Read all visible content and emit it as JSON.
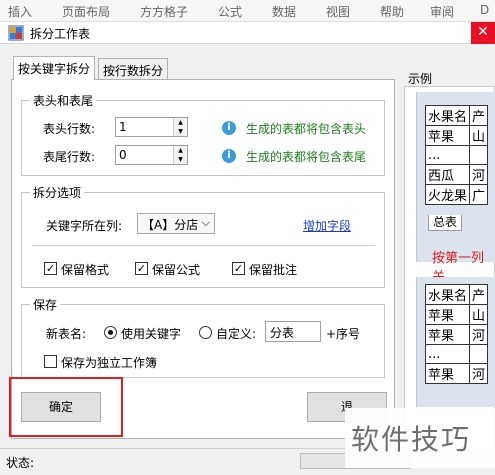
{
  "ribbon": [
    "插入",
    "页面布局",
    "方方格子",
    "公式",
    "数据",
    "视图",
    "帮助",
    "审阅",
    "D"
  ],
  "window": {
    "title": "拆分工作表",
    "close": "✕"
  },
  "tabs": [
    "按关键字拆分",
    "按行数拆分"
  ],
  "header_footer": {
    "legend": "表头和表尾",
    "header_label": "表头行数:",
    "header_value": "1",
    "header_hint": "生成的表都将包含表头",
    "footer_label": "表尾行数:",
    "footer_value": "0",
    "footer_hint": "生成的表都将包含表尾",
    "info_glyph": "i"
  },
  "split_options": {
    "legend": "拆分选项",
    "key_col_label": "关键字所在列:",
    "key_col_value": "【A】分店",
    "add_field": "增加字段",
    "keep_format": "保留格式",
    "keep_formula": "保留公式",
    "keep_comment": "保留批注",
    "check_glyph": "✓"
  },
  "save": {
    "legend": "保存",
    "new_name_label": "新表名:",
    "use_key": "使用关键字",
    "custom": "自定义:",
    "custom_value": "分表",
    "suffix": "+序号",
    "separate_workbook": "保存为独立工作簿"
  },
  "buttons": {
    "ok": "确定",
    "exit": "退"
  },
  "example": {
    "label": "示例",
    "table1": [
      [
        "水果名",
        "产"
      ],
      [
        "苹果",
        "山"
      ],
      [
        "...",
        ""
      ],
      [
        "西瓜",
        "河"
      ],
      [
        "火龙果",
        "广"
      ]
    ],
    "sheet_tab": "总表",
    "split_text": "按第一列关",
    "table2": [
      [
        "水果名",
        "产"
      ],
      [
        "苹果",
        "山"
      ],
      [
        "苹果",
        "河"
      ],
      [
        "...",
        ""
      ],
      [
        "苹果",
        "河"
      ]
    ]
  },
  "status": {
    "label": "状态:"
  },
  "watermark": "软件技巧",
  "colors": {
    "highlight_box": "#e02020",
    "hint_text": "#1f7a1f",
    "link": "#1a3fbf"
  }
}
